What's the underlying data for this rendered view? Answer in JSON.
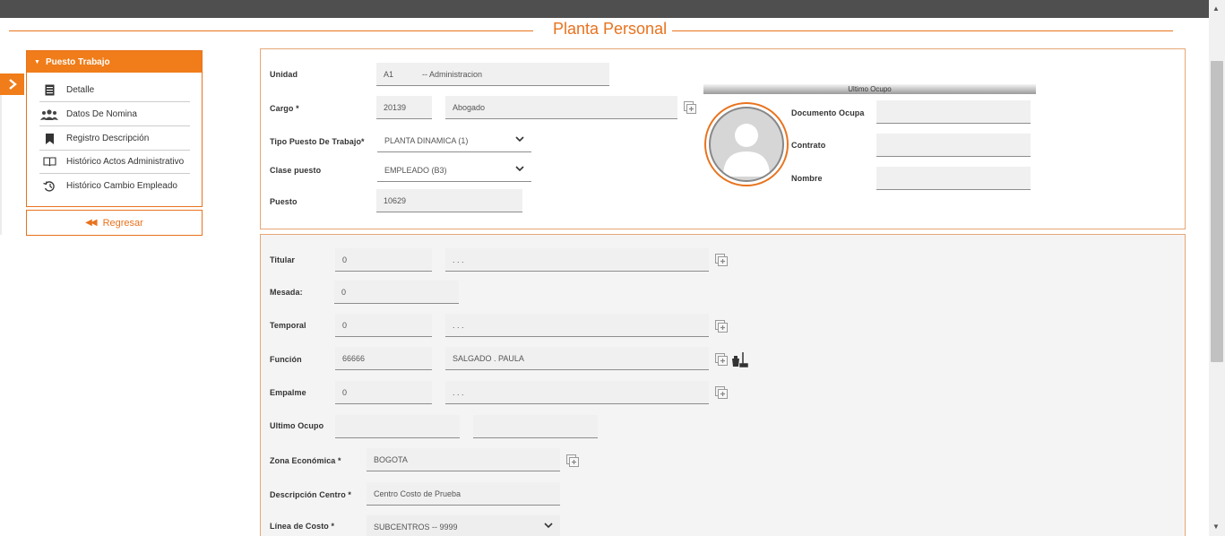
{
  "page": {
    "title": "Planta Personal"
  },
  "sidebar": {
    "header": "Puesto Trabajo",
    "items": [
      {
        "label": "Detalle",
        "icon": "document-list-icon"
      },
      {
        "label": "Datos De Nomina",
        "icon": "users-group-icon"
      },
      {
        "label": "Registro Descripción",
        "icon": "bookmark-icon"
      },
      {
        "label": "Histórico Actos Administrativo",
        "icon": "open-book-icon"
      },
      {
        "label": "Histórico Cambio Empleado",
        "icon": "history-icon"
      }
    ],
    "back_label": "Regresar"
  },
  "job": {
    "unidad_label": "Unidad",
    "unidad_code": "A1",
    "unidad_name": "-- Administracion",
    "cargo_label": "Cargo *",
    "cargo_code": "20139",
    "cargo_name": "Abogado",
    "tipo_label": "Tipo Puesto De Trabajo*",
    "tipo_value": "PLANTA DINAMICA (1)",
    "clase_label": "Clase puesto",
    "clase_value": "EMPLEADO (B3)",
    "puesto_label": "Puesto",
    "puesto_value": "10629"
  },
  "ultimo_ocupo": {
    "header": "Ultimo Ocupo",
    "documento_label": "Documento Ocupa",
    "documento_value": "",
    "contrato_label": "Contrato",
    "contrato_value": "",
    "nombre_label": "Nombre",
    "nombre_value": ""
  },
  "detail": {
    "titular_label": "Titular",
    "titular_code": "0",
    "titular_name": ". . .",
    "mesada_label": "Mesada:",
    "mesada_value": "0",
    "temporal_label": "Temporal",
    "temporal_code": "0",
    "temporal_name": ". . .",
    "funcion_label": "Función",
    "funcion_code": "66666",
    "funcion_name": "SALGADO . PAULA",
    "empalme_label": "Empalme",
    "empalme_code": "0",
    "empalme_name": ". . .",
    "ultimo_label": "Ultimo Ocupo",
    "ultimo_code": "",
    "ultimo_name": "",
    "zona_label": "Zona Económica *",
    "zona_value": "BOGOTA",
    "desc_label": "Descripción Centro *",
    "desc_value": "Centro Costo de Prueba",
    "linea_label": "Línea de Costo *",
    "linea_value": "SUBCENTROS -- 9999"
  },
  "colors": {
    "accent": "#f07d19",
    "accent_text": "#e8731e"
  }
}
